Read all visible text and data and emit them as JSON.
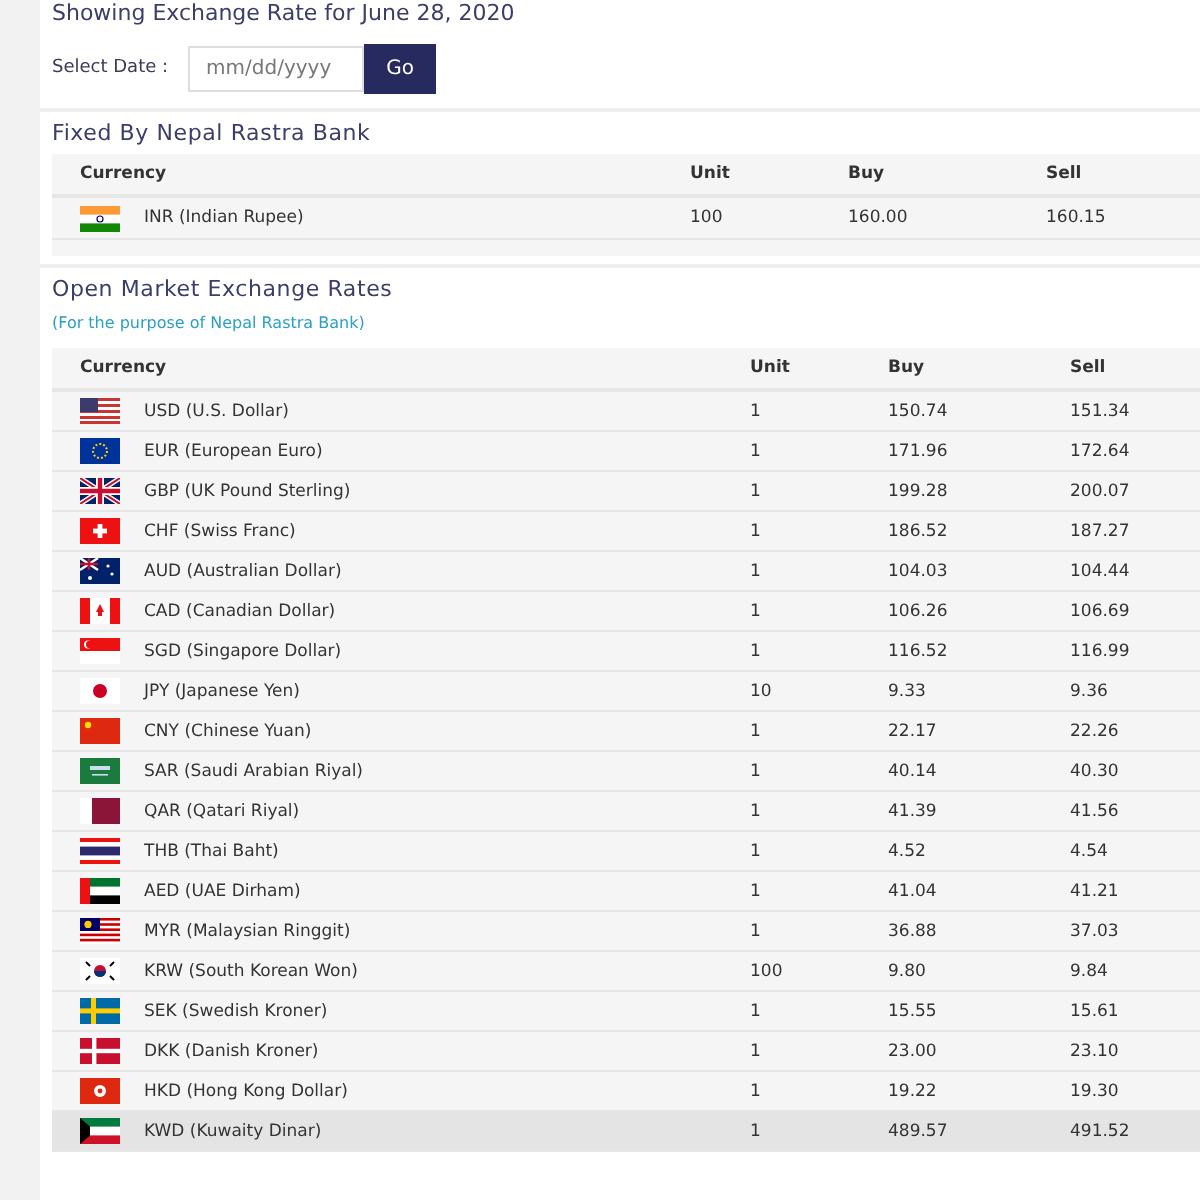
{
  "heading": "Showing Exchange Rate for June 28, 2020",
  "date_picker": {
    "label": "Select Date :",
    "placeholder": "mm/dd/yyyy",
    "button": "Go"
  },
  "fixed_section": {
    "title": "Fixed By Nepal Rastra Bank",
    "table": {
      "columns": [
        "Currency",
        "Unit",
        "Buy",
        "Sell"
      ],
      "rows": [
        {
          "currency": "INR (Indian Rupee)",
          "unit": "100",
          "buy": "160.00",
          "sell": "160.15",
          "highlighted": false
        }
      ]
    }
  },
  "open_section": {
    "title": "Open Market Exchange Rates",
    "subtitle": "(For the purpose of Nepal Rastra Bank)",
    "table": {
      "columns": [
        "Currency",
        "Unit",
        "Buy",
        "Sell"
      ],
      "rows": [
        {
          "currency": "USD (U.S. Dollar)",
          "unit": "1",
          "buy": "150.74",
          "sell": "151.34",
          "highlighted": false
        },
        {
          "currency": "EUR (European Euro)",
          "unit": "1",
          "buy": "171.96",
          "sell": "172.64",
          "highlighted": false
        },
        {
          "currency": "GBP (UK Pound Sterling)",
          "unit": "1",
          "buy": "199.28",
          "sell": "200.07",
          "highlighted": false
        },
        {
          "currency": "CHF (Swiss Franc)",
          "unit": "1",
          "buy": "186.52",
          "sell": "187.27",
          "highlighted": false
        },
        {
          "currency": "AUD (Australian Dollar)",
          "unit": "1",
          "buy": "104.03",
          "sell": "104.44",
          "highlighted": false
        },
        {
          "currency": "CAD (Canadian Dollar)",
          "unit": "1",
          "buy": "106.26",
          "sell": "106.69",
          "highlighted": false
        },
        {
          "currency": "SGD (Singapore Dollar)",
          "unit": "1",
          "buy": "116.52",
          "sell": "116.99",
          "highlighted": false
        },
        {
          "currency": "JPY (Japanese Yen)",
          "unit": "10",
          "buy": "9.33",
          "sell": "9.36",
          "highlighted": false
        },
        {
          "currency": "CNY (Chinese Yuan)",
          "unit": "1",
          "buy": "22.17",
          "sell": "22.26",
          "highlighted": false
        },
        {
          "currency": "SAR (Saudi Arabian Riyal)",
          "unit": "1",
          "buy": "40.14",
          "sell": "40.30",
          "highlighted": false
        },
        {
          "currency": "QAR (Qatari Riyal)",
          "unit": "1",
          "buy": "41.39",
          "sell": "41.56",
          "highlighted": false
        },
        {
          "currency": "THB (Thai Baht)",
          "unit": "1",
          "buy": "4.52",
          "sell": "4.54",
          "highlighted": false
        },
        {
          "currency": "AED (UAE Dirham)",
          "unit": "1",
          "buy": "41.04",
          "sell": "41.21",
          "highlighted": false
        },
        {
          "currency": "MYR (Malaysian Ringgit)",
          "unit": "1",
          "buy": "36.88",
          "sell": "37.03",
          "highlighted": false
        },
        {
          "currency": "KRW (South Korean Won)",
          "unit": "100",
          "buy": "9.80",
          "sell": "9.84",
          "highlighted": false
        },
        {
          "currency": "SEK (Swedish Kroner)",
          "unit": "1",
          "buy": "15.55",
          "sell": "15.61",
          "highlighted": false
        },
        {
          "currency": "DKK (Danish Kroner)",
          "unit": "1",
          "buy": "23.00",
          "sell": "23.10",
          "highlighted": false
        },
        {
          "currency": "HKD (Hong Kong Dollar)",
          "unit": "1",
          "buy": "19.22",
          "sell": "19.30",
          "highlighted": false
        },
        {
          "currency": "KWD (Kuwaity Dinar)",
          "unit": "1",
          "buy": "489.57",
          "sell": "491.52",
          "highlighted": true
        }
      ]
    }
  }
}
